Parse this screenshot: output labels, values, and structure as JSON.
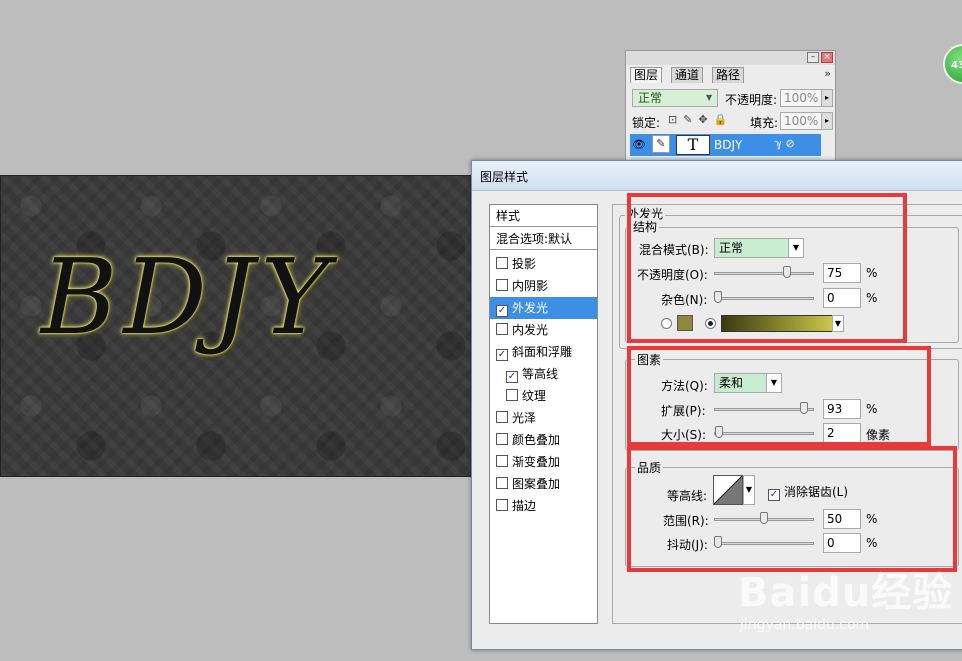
{
  "canvas": {
    "art_text": "BDJY"
  },
  "layers_panel": {
    "tabs": [
      "图层",
      "通道",
      "路径"
    ],
    "menu_glyph": "»",
    "blend_mode": "正常",
    "opacity_label": "不透明度:",
    "opacity_value": "100%",
    "lock_label": "锁定:",
    "fill_label": "填充:",
    "fill_value": "100%",
    "layer_name": "BDJY",
    "layer_thumb": "T",
    "win_min": "–",
    "win_close": "×",
    "arrow": "▸"
  },
  "green_ball": {
    "text": "43"
  },
  "dialog": {
    "title": "图层样式",
    "styles_list": {
      "header": "样式",
      "blend_default": "混合选项:默认",
      "items": [
        {
          "label": "投影",
          "checked": false
        },
        {
          "label": "内阴影",
          "checked": false
        },
        {
          "label": "外发光",
          "checked": true,
          "selected": true
        },
        {
          "label": "内发光",
          "checked": false
        },
        {
          "label": "斜面和浮雕",
          "checked": true
        },
        {
          "label": "等高线",
          "checked": true,
          "indent": true
        },
        {
          "label": "纹理",
          "checked": false,
          "indent": true
        },
        {
          "label": "光泽",
          "checked": false
        },
        {
          "label": "颜色叠加",
          "checked": false
        },
        {
          "label": "渐变叠加",
          "checked": false
        },
        {
          "label": "图案叠加",
          "checked": false
        },
        {
          "label": "描边",
          "checked": false
        }
      ]
    },
    "outer_glow": {
      "section_title": "外发光",
      "structure_title": "结构",
      "blend_mode_label": "混合模式(B):",
      "blend_mode_value": "正常",
      "opacity_label": "不透明度(O):",
      "opacity_value": "75",
      "opacity_fraction": 0.75,
      "noise_label": "杂色(N):",
      "noise_value": "0",
      "noise_fraction": 0,
      "pct": "%",
      "color_swatch": "#8c8a3a",
      "gradient_from": "#3a3a10",
      "gradient_to": "#c8c84a"
    },
    "elements": {
      "title": "图素",
      "method_label": "方法(Q):",
      "method_value": "柔和",
      "spread_label": "扩展(P):",
      "spread_value": "93",
      "spread_fraction": 0.93,
      "size_label": "大小(S):",
      "size_value": "2",
      "size_unit": "像素",
      "size_fraction": 0.01
    },
    "quality": {
      "title": "品质",
      "contour_label": "等高线:",
      "antialias_label": "消除锯齿(L)",
      "antialias_checked": true,
      "range_label": "范围(R):",
      "range_value": "50",
      "range_fraction": 0.5,
      "jitter_label": "抖动(J):",
      "jitter_value": "0",
      "jitter_fraction": 0
    }
  },
  "watermark": {
    "logo": "Baidu经验",
    "url": "jingyan.baidu.com"
  },
  "colors": {
    "highlight_red": "#e83a3a",
    "selection_blue": "#3d8fe6"
  }
}
